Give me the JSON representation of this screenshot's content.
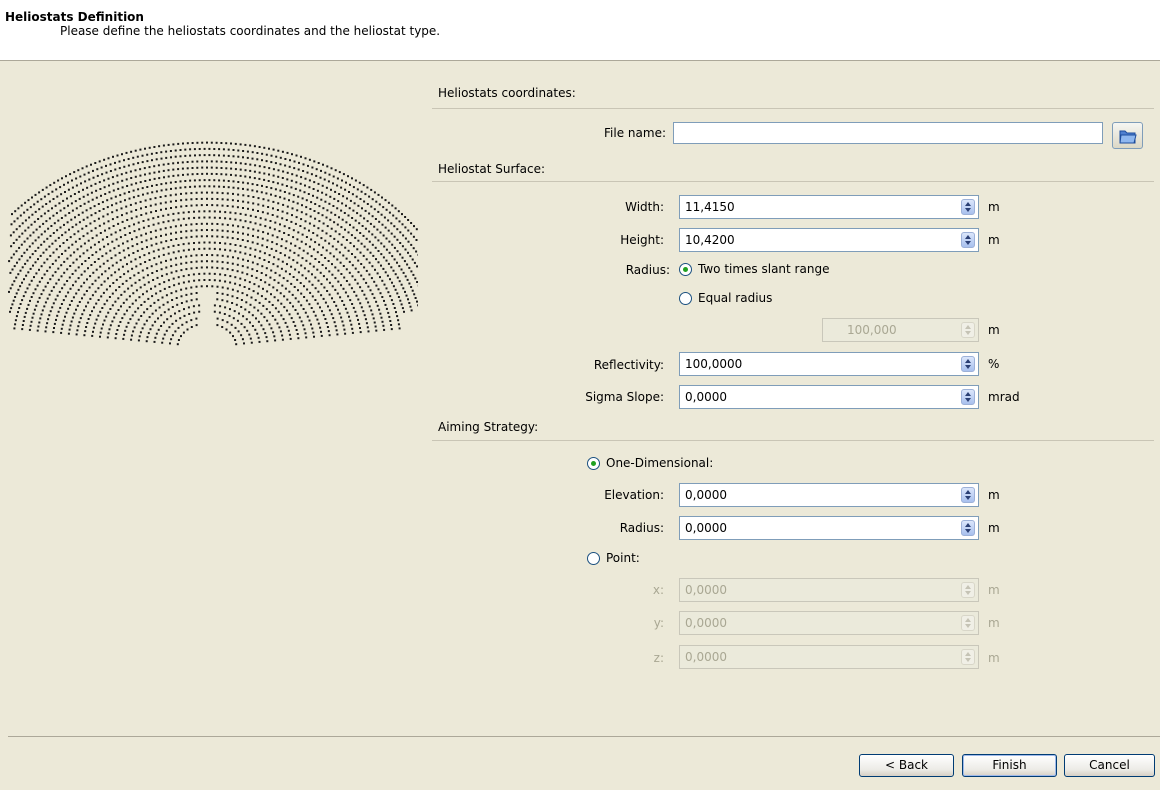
{
  "header": {
    "title": "Heliostats Definition",
    "subtitle": "Please define the heliostats coordinates and the heliostat type."
  },
  "coordinates": {
    "section": "Heliostats coordinates:",
    "file_label": "File name:",
    "file_value": ""
  },
  "surface": {
    "section": "Heliostat Surface:",
    "width_label": "Width:",
    "width_value": "11,4150",
    "width_unit": "m",
    "height_label": "Height:",
    "height_value": "10,4200",
    "height_unit": "m",
    "radius_label": "Radius:",
    "radius_opt1": "Two times slant range",
    "radius_opt2": "Equal radius",
    "radius_value": "100,000",
    "radius_unit": "m",
    "reflectivity_label": "Reflectivity:",
    "reflectivity_value": "100,0000",
    "reflectivity_unit": "%",
    "sigma_label": "Sigma Slope:",
    "sigma_value": "0,0000",
    "sigma_unit": "mrad"
  },
  "aiming": {
    "section": "Aiming Strategy:",
    "one_dim": "One-Dimensional:",
    "elevation_label": "Elevation:",
    "elevation_value": "0,0000",
    "elevation_unit": "m",
    "radius_label": "Radius:",
    "radius_value": "0,0000",
    "radius_unit": "m",
    "point": "Point:",
    "x_label": "x:",
    "x_value": "0,0000",
    "x_unit": "m",
    "y_label": "y:",
    "y_value": "0,0000",
    "y_unit": "m",
    "z_label": "z:",
    "z_value": "0,0000",
    "z_unit": "m"
  },
  "buttons": {
    "back": "< Back",
    "finish": "Finish",
    "cancel": "Cancel"
  },
  "colors": {
    "window_bg": "#ece9d8",
    "field_border": "#7f9db9",
    "radio_selected": "#21a121"
  },
  "icons": {
    "browse": "open-folder-icon"
  }
}
